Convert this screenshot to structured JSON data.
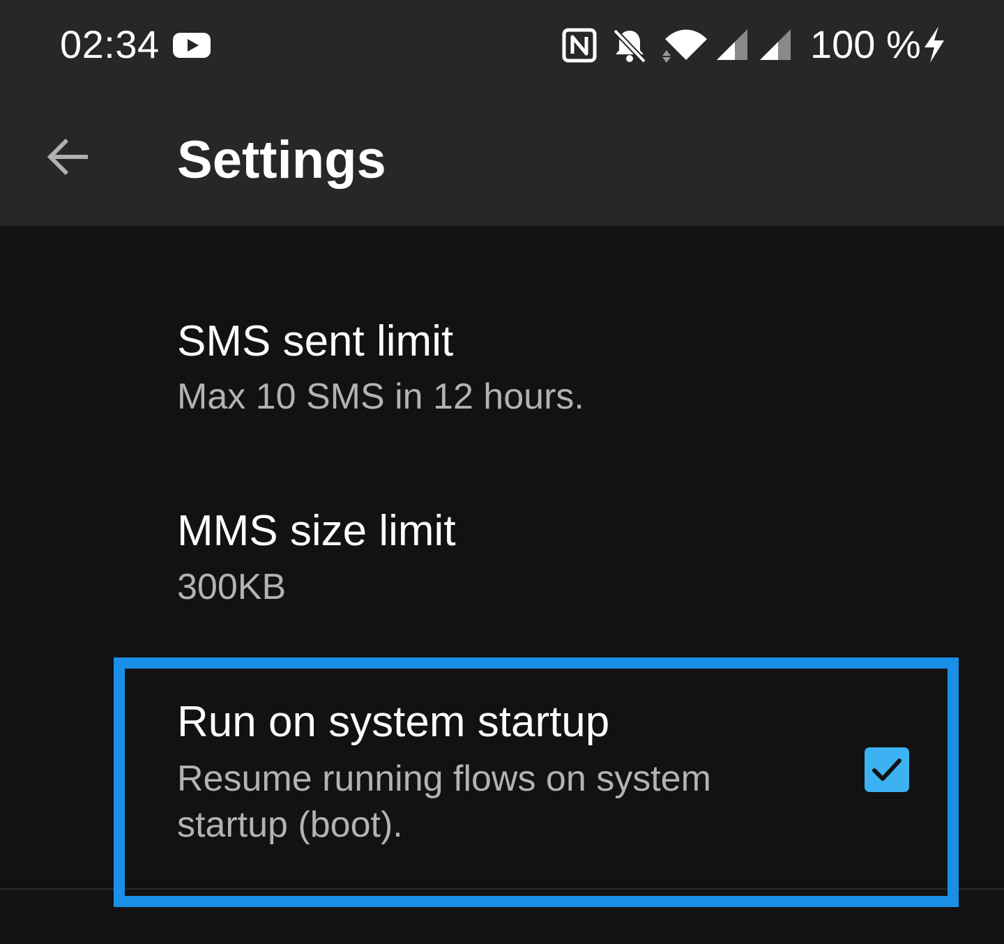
{
  "status_bar": {
    "time": "02:34",
    "battery": "100 %",
    "icons": [
      "youtube-icon",
      "nfc-icon",
      "bell-off-icon",
      "wifi-icon",
      "signal-icon",
      "signal-icon",
      "charging-bolt-icon"
    ]
  },
  "app_bar": {
    "title": "Settings",
    "back_icon": "arrow-left-icon"
  },
  "preferences": [
    {
      "title": "SMS sent limit",
      "summary": "Max 10 SMS in 12 hours."
    },
    {
      "title": "MMS size limit",
      "summary": "300KB"
    },
    {
      "title": "Run on system startup",
      "summary_line1": "Resume running flows on system",
      "summary_line2": "startup (boot).",
      "checked": true
    }
  ],
  "colors": {
    "bar_bg": "#272727",
    "page_bg": "#121212",
    "highlight": "#1a8fe8",
    "checkbox": "#3db2f2"
  }
}
